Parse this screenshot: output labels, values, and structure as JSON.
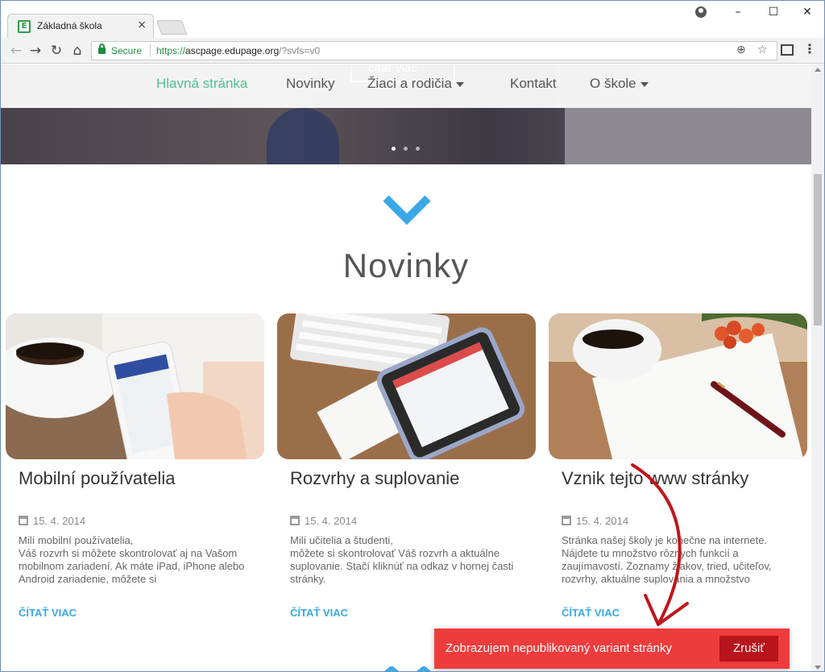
{
  "browser": {
    "tab_title": "Základná škola",
    "tab_close": "×",
    "secure_label": "Secure",
    "url_scheme": "https://",
    "url_host": "ascpage.edupage.org",
    "url_query": "/?svfs=v0",
    "window_controls": [
      "–",
      "☐",
      "✕"
    ],
    "nav_icons": [
      "back-icon",
      "forward-icon",
      "reload-icon",
      "home-icon"
    ]
  },
  "site": {
    "nav": [
      {
        "label": "Hlavná stránka",
        "active": true,
        "dropdown": false
      },
      {
        "label": "Novinky",
        "active": false,
        "dropdown": false
      },
      {
        "label": "Žiaci a rodičia",
        "active": false,
        "dropdown": true
      },
      {
        "label": "Kontakt",
        "active": false,
        "dropdown": false
      },
      {
        "label": "O škole",
        "active": false,
        "dropdown": true
      }
    ],
    "hero_button": "čítať viac",
    "section_title": "Novinky",
    "cards": [
      {
        "title": "Mobilní používatelia",
        "date": "15. 4. 2014",
        "text": "Milí mobilní používatelia,\nVáš rozvrh si môžete skontrolovať aj na Vašom mobilnom zariadení. Ak máte iPad, iPhone alebo Android zariadenie, môžete si",
        "more": "ČÍTAŤ VIAC"
      },
      {
        "title": "Rozvrhy a suplovanie",
        "date": "15. 4. 2014",
        "text": "Milí učitelia a študenti,\nmôžete si skontrolovať Váš rozvrh a aktuálne suplovanie. Stačí kliknúť na odkaz v hornej časti stránky.",
        "more": "ČÍTAŤ VIAC"
      },
      {
        "title": "Vznik tejto www stránky",
        "date": "15. 4. 2014",
        "text": "Stránka našej školy je konečne na internete. Nájdete tu množstvo rôznych funkcií a zaujímavostí. Zoznamy žiakov, tried, učiteľov, rozvrhy, aktuálne suplovania a množstvo",
        "more": "ČÍTAŤ VIAC"
      }
    ]
  },
  "toast": {
    "message": "Zobrazujem nepublikovaný variant stránky",
    "cancel_label": "Zrušiť"
  },
  "colors": {
    "accent_green": "#4fbf8f",
    "accent_blue": "#3aa8e6",
    "toast_red": "#ee3c3c",
    "toast_button": "#b8141b",
    "annotation_arrow": "#c0161c"
  }
}
